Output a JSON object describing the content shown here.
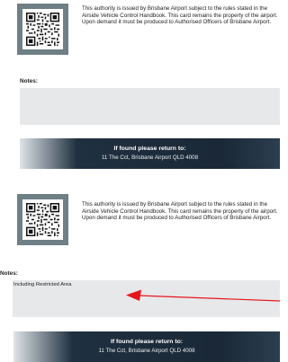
{
  "cards": [
    {
      "authority_text": "This authority is issued by Brisbane Airport subject to the rules stated in the Airside Vehicle Control Handbook. This card remains the property of the airport. Upon demand it must be produced to Authorised Officers of Brisbane Airport.",
      "notes_label": "Notes:",
      "notes_value": "",
      "footer_title": "If found please return to:",
      "footer_address": "11 The Cct, Brisbane Airport QLD 4008"
    },
    {
      "authority_text": "This authority is issued by Brisbane Airport subject to the rules stated in the Airside Vehicle Control Handbook. This card remains the property of the airport. Upon demand it must be produced to Authorised Officers of Brisbane Airport.",
      "notes_label": "Notes:",
      "notes_value": "Including Restricted Area",
      "footer_title": "If found please return to:",
      "footer_address": "11 The Cct, Brisbane Airport QLD 4008"
    }
  ],
  "icons": {
    "qr": "qr-code-icon",
    "arrow": "red-arrow-icon"
  },
  "colors": {
    "qr_frame": "#6e7f86",
    "notes_box": "#e6e8ea",
    "footer_dark": "#1a2837",
    "arrow": "#e8161b"
  }
}
